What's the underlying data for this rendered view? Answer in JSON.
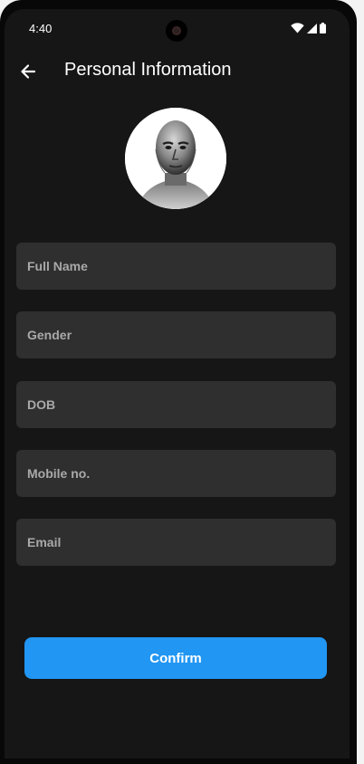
{
  "status_bar": {
    "time": "4:40",
    "icons": [
      "wifi-icon",
      "signal-icon",
      "battery-icon"
    ]
  },
  "app_bar": {
    "back_icon": "arrow-left-icon",
    "title": "Personal Information"
  },
  "avatar": {
    "icon": "profile-photo"
  },
  "form": {
    "full_name": {
      "value": "",
      "placeholder": "Full Name"
    },
    "gender": {
      "value": "",
      "placeholder": "Gender"
    },
    "dob": {
      "value": "",
      "placeholder": "DOB"
    },
    "mobile": {
      "value": "",
      "placeholder": "Mobile no."
    },
    "email": {
      "value": "",
      "placeholder": "Email"
    }
  },
  "confirm_label": "Confirm",
  "colors": {
    "background": "#161616",
    "field_background": "#2f2f2f",
    "placeholder": "#a9a9a9",
    "accent": "#2196f3",
    "text": "#ffffff"
  }
}
